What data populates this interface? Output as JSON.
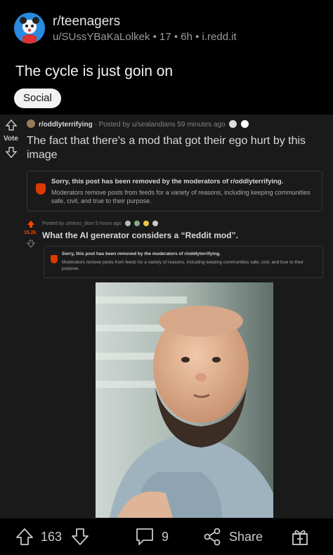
{
  "post": {
    "subreddit": "r/teenagers",
    "meta": "u/SUssYBaKaLolkek • 17 • 6h • i.redd.it",
    "title": "The cycle is just goin on",
    "flair": "Social"
  },
  "screenshot": {
    "vote_label": "Vote",
    "subreddit": "r/oddlyterrifying",
    "posted_by": "· Posted by u/sealandians 59 minutes ago",
    "title": "The fact that there's a mod that got their ego hurt by this image",
    "removed_title": "Sorry, this post has been removed by the moderators of r/oddlyterrifying.",
    "removed_text": "Moderators remove posts from feeds for a variety of reasons, including keeping communities safe, civil, and true to their purpose.",
    "inner": {
      "score": "15.2k",
      "meta": "Posted by u/micro_door 5 hours ago",
      "title": "What the AI generator considers a “Reddit mod”.",
      "removed_title": "Sorry, this post has been removed by the moderators of r/oddlyterrifying.",
      "removed_text": "Moderators remove posts from feeds for a variety of reasons, including keeping communities safe, civil, and true to their purpose."
    }
  },
  "actions": {
    "votes": "163",
    "comments": "9",
    "share": "Share"
  },
  "colors": {
    "background": "#000000",
    "screenshot_bg": "#1a1a1b",
    "removed_icon": "#d93a00",
    "upvote_active": "#ff4500"
  }
}
